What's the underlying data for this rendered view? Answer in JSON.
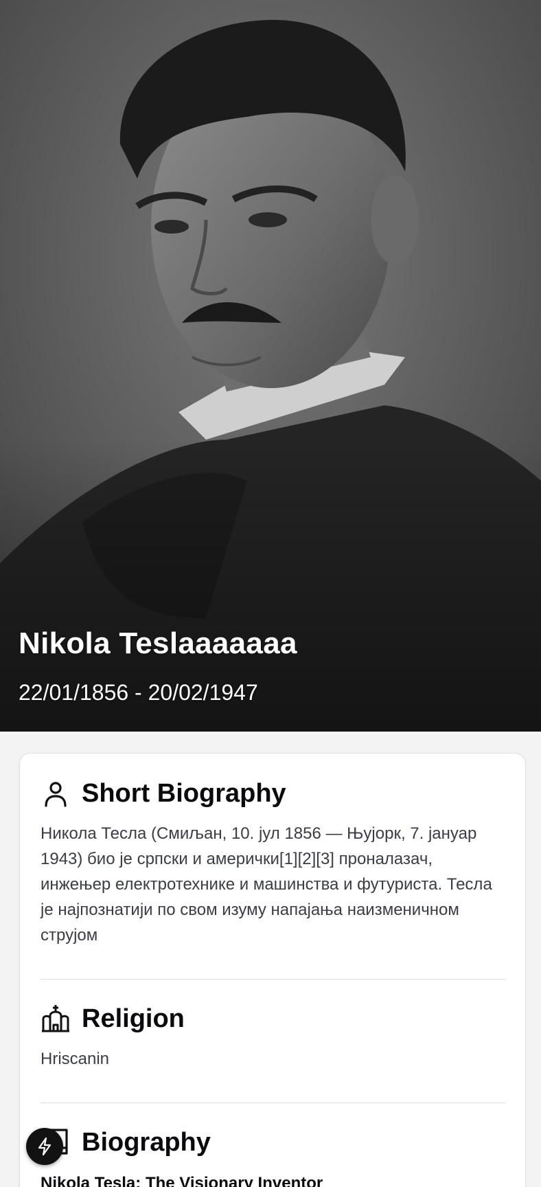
{
  "hero": {
    "name": "Nikola Teslaaaaaaa",
    "dates": "22/01/1856 - 20/02/1947",
    "photo": "black-and-white portrait"
  },
  "sections": {
    "biography_short": {
      "icon": "person-icon",
      "title": "Short Biography",
      "text": "Никола Тесла (Смиљан, 10. јул 1856 — Њујорк, 7. јануар 1943) био је српски и амерички[1][2][3] проналазач, инжењер електротехнике и машинства и футуриста. Тесла је најпознатији по свом изуму напајања наизменичном струјом"
    },
    "religion": {
      "icon": "church-icon",
      "title": "Religion",
      "text": "Hriscanin"
    },
    "biography": {
      "icon": "book-icon",
      "title": "Biography",
      "subtitle": "Nikola Tesla: The Visionary Inventor"
    }
  },
  "fab": {
    "icon": "lightning-bolt-icon"
  },
  "colors": {
    "card_bg": "#ffffff",
    "page_bg": "#f3f3f4",
    "fab_bg": "#121212"
  }
}
